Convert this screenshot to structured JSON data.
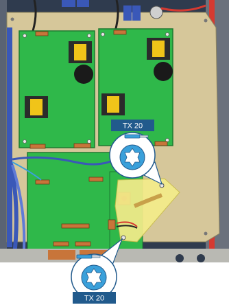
{
  "callouts": [
    {
      "id": "upper",
      "tool_label": "TX 20",
      "icon": "torx-tx20-icon",
      "screwdriver_icon": "screwdriver-icon"
    },
    {
      "id": "lower",
      "tool_label": "TX 20",
      "icon": "torx-tx20-icon",
      "screwdriver_icon": "screwdriver-icon"
    }
  ],
  "colors": {
    "board_green": "#2fb84a",
    "frame_gray": "#b9b9b3",
    "tan_panel": "#d6c79a",
    "dark_frame": "#2f3b4e",
    "red_accent": "#d63a31",
    "highlight_yellow": "#f4ec8a",
    "callout_blue": "#215a8c",
    "callout_fill": "#3aa0da",
    "transformer_yellow": "#f0c419",
    "cable_blue": "#3a58b8"
  }
}
